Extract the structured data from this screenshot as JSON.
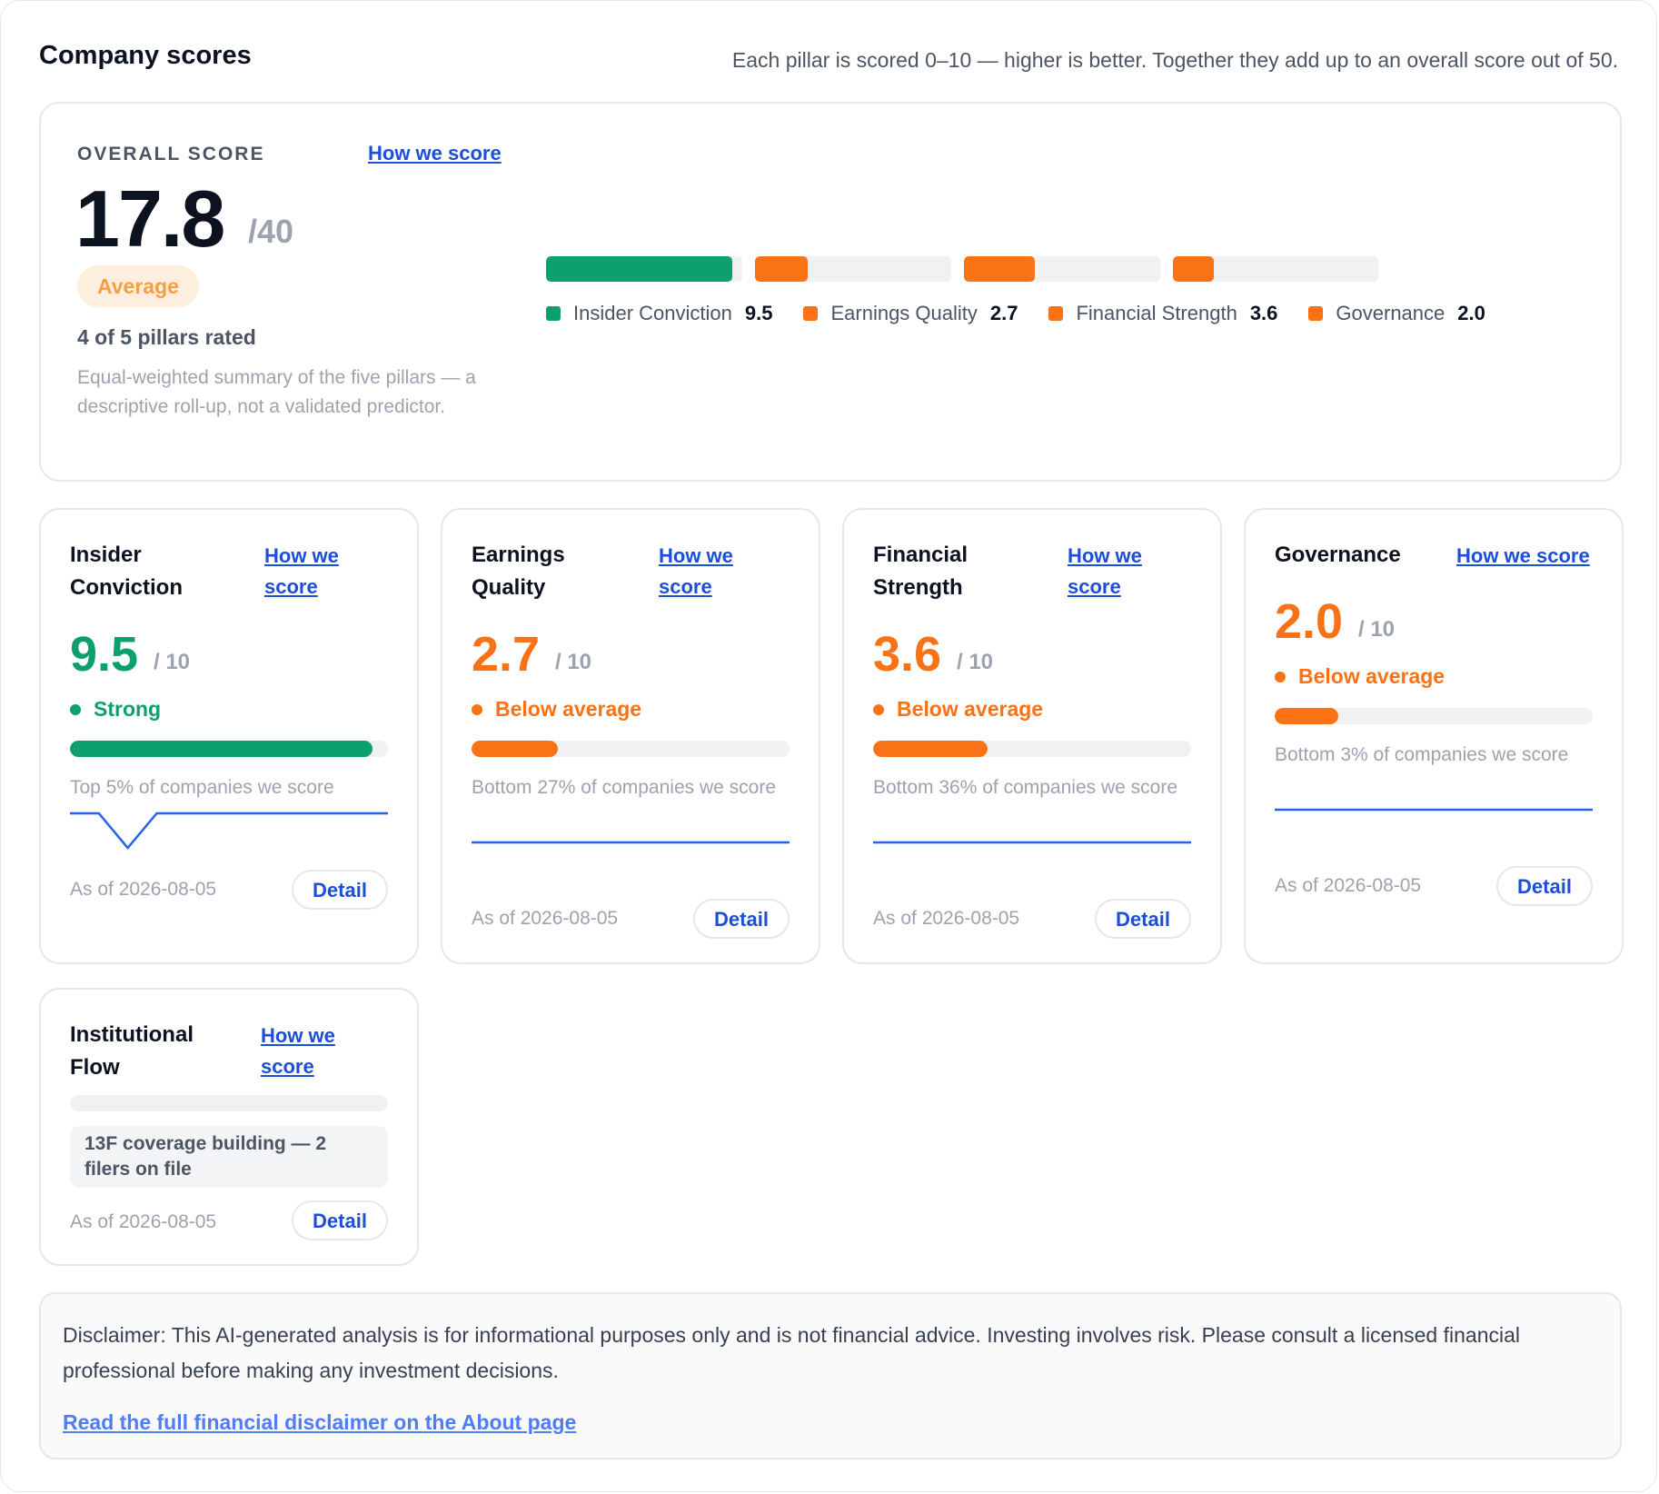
{
  "header": {
    "title": "Company scores",
    "subtitle": "Each pillar is scored 0–10 — higher is better. Together they add up to an overall score out of 50."
  },
  "overall": {
    "label": "OVERALL SCORE",
    "how_link": "How we score",
    "score": "17.8",
    "max": "/40",
    "badge": "Average",
    "rated": "4 of 5 pillars rated",
    "description": "Equal-weighted summary of the five pillars — a descriptive roll-up, not a validated predictor.",
    "segments": [
      {
        "name": "Insider Conviction",
        "value": "9.5",
        "fraction": 0.95,
        "color": "#0e9f6e"
      },
      {
        "name": "Earnings Quality",
        "value": "2.7",
        "fraction": 0.27,
        "color": "#f97316"
      },
      {
        "name": "Financial Strength",
        "value": "3.6",
        "fraction": 0.36,
        "color": "#f97316"
      },
      {
        "name": "Governance",
        "value": "2.0",
        "fraction": 0.2,
        "color": "#f97316"
      }
    ]
  },
  "pillars": [
    {
      "title": "Insider Conviction",
      "how_link": "How we score",
      "score": "9.5",
      "max": "/ 10",
      "status": "Strong",
      "color": "#0e9f6e",
      "fraction": 0.95,
      "percentile": "Top 5% of companies we score",
      "as_of": "As of 2026-08-05",
      "detail": "Detail",
      "sparkline": [
        1,
        1,
        0,
        1,
        1,
        1,
        1,
        1,
        1,
        1,
        1,
        1
      ]
    },
    {
      "title": "Earnings Quality",
      "how_link": "How we score",
      "score": "2.7",
      "max": "/ 10",
      "status": "Below average",
      "color": "#f97316",
      "fraction": 0.27,
      "percentile": "Bottom 27% of companies we score",
      "as_of": "As of 2026-08-05",
      "detail": "Detail",
      "sparkline": [
        1,
        1
      ]
    },
    {
      "title": "Financial Strength",
      "how_link": "How we score",
      "score": "3.6",
      "max": "/ 10",
      "status": "Below average",
      "color": "#f97316",
      "fraction": 0.36,
      "percentile": "Bottom 36% of companies we score",
      "as_of": "As of 2026-08-05",
      "detail": "Detail",
      "sparkline": [
        1,
        1
      ]
    },
    {
      "title": "Governance",
      "how_link": "How we score",
      "score": "2.0",
      "max": "/ 10",
      "status": "Below average",
      "color": "#f97316",
      "fraction": 0.2,
      "percentile": "Bottom 3% of companies we score",
      "as_of": "As of 2026-08-05",
      "detail": "Detail",
      "sparkline": [
        1,
        1
      ]
    },
    {
      "title": "Institutional Flow",
      "how_link": "How we score",
      "note": "13F coverage building — 2 filers on file",
      "as_of": "As of 2026-08-05",
      "detail": "Detail"
    }
  ],
  "disclaimer": {
    "text": "Disclaimer: This AI-generated analysis is for informational purposes only and is not financial advice. Investing involves risk. Please consult a licensed financial professional before making any investment decisions.",
    "link": "Read the full financial disclaimer on the About page"
  },
  "colors": {
    "strong": "#0e9f6e",
    "below_average": "#f97316",
    "link": "#1d4ed8",
    "sparkline": "#2563eb"
  }
}
